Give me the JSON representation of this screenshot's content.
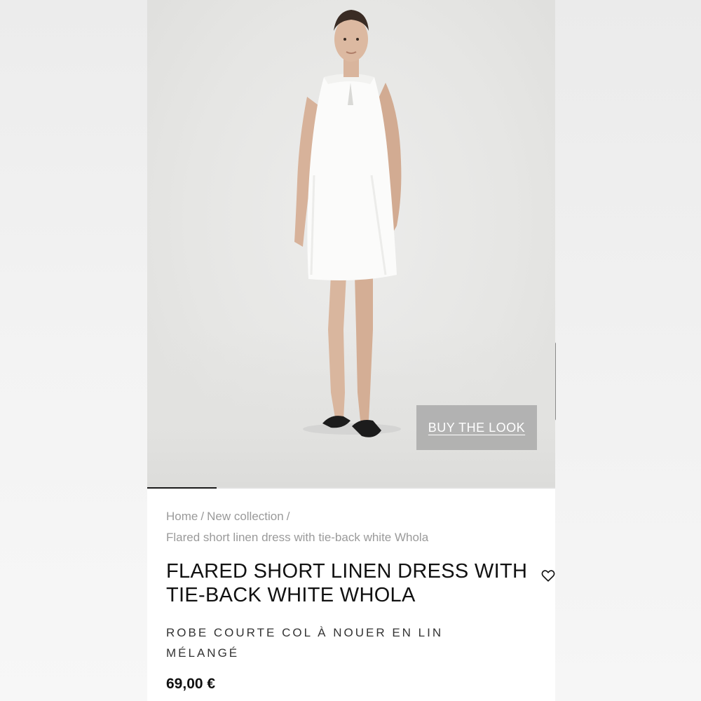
{
  "product_image": {
    "alt": "Model wearing a flared short white linen halter dress",
    "buy_the_look_label": "BUY THE LOOK",
    "gallery_progress": 0.17
  },
  "breadcrumb": {
    "items": [
      "Home",
      "New collection"
    ],
    "separator": "/",
    "current": "Flared short linen dress with tie-back white Whola"
  },
  "product": {
    "title": "FLARED SHORT LINEN DRESS WITH TIE-BACK WHITE WHOLA",
    "subtitle": "ROBE COURTE COL À NOUER EN LIN MÉLANGÉ",
    "price": "69,00 €",
    "wishlist_icon": "heart-outline-icon"
  }
}
